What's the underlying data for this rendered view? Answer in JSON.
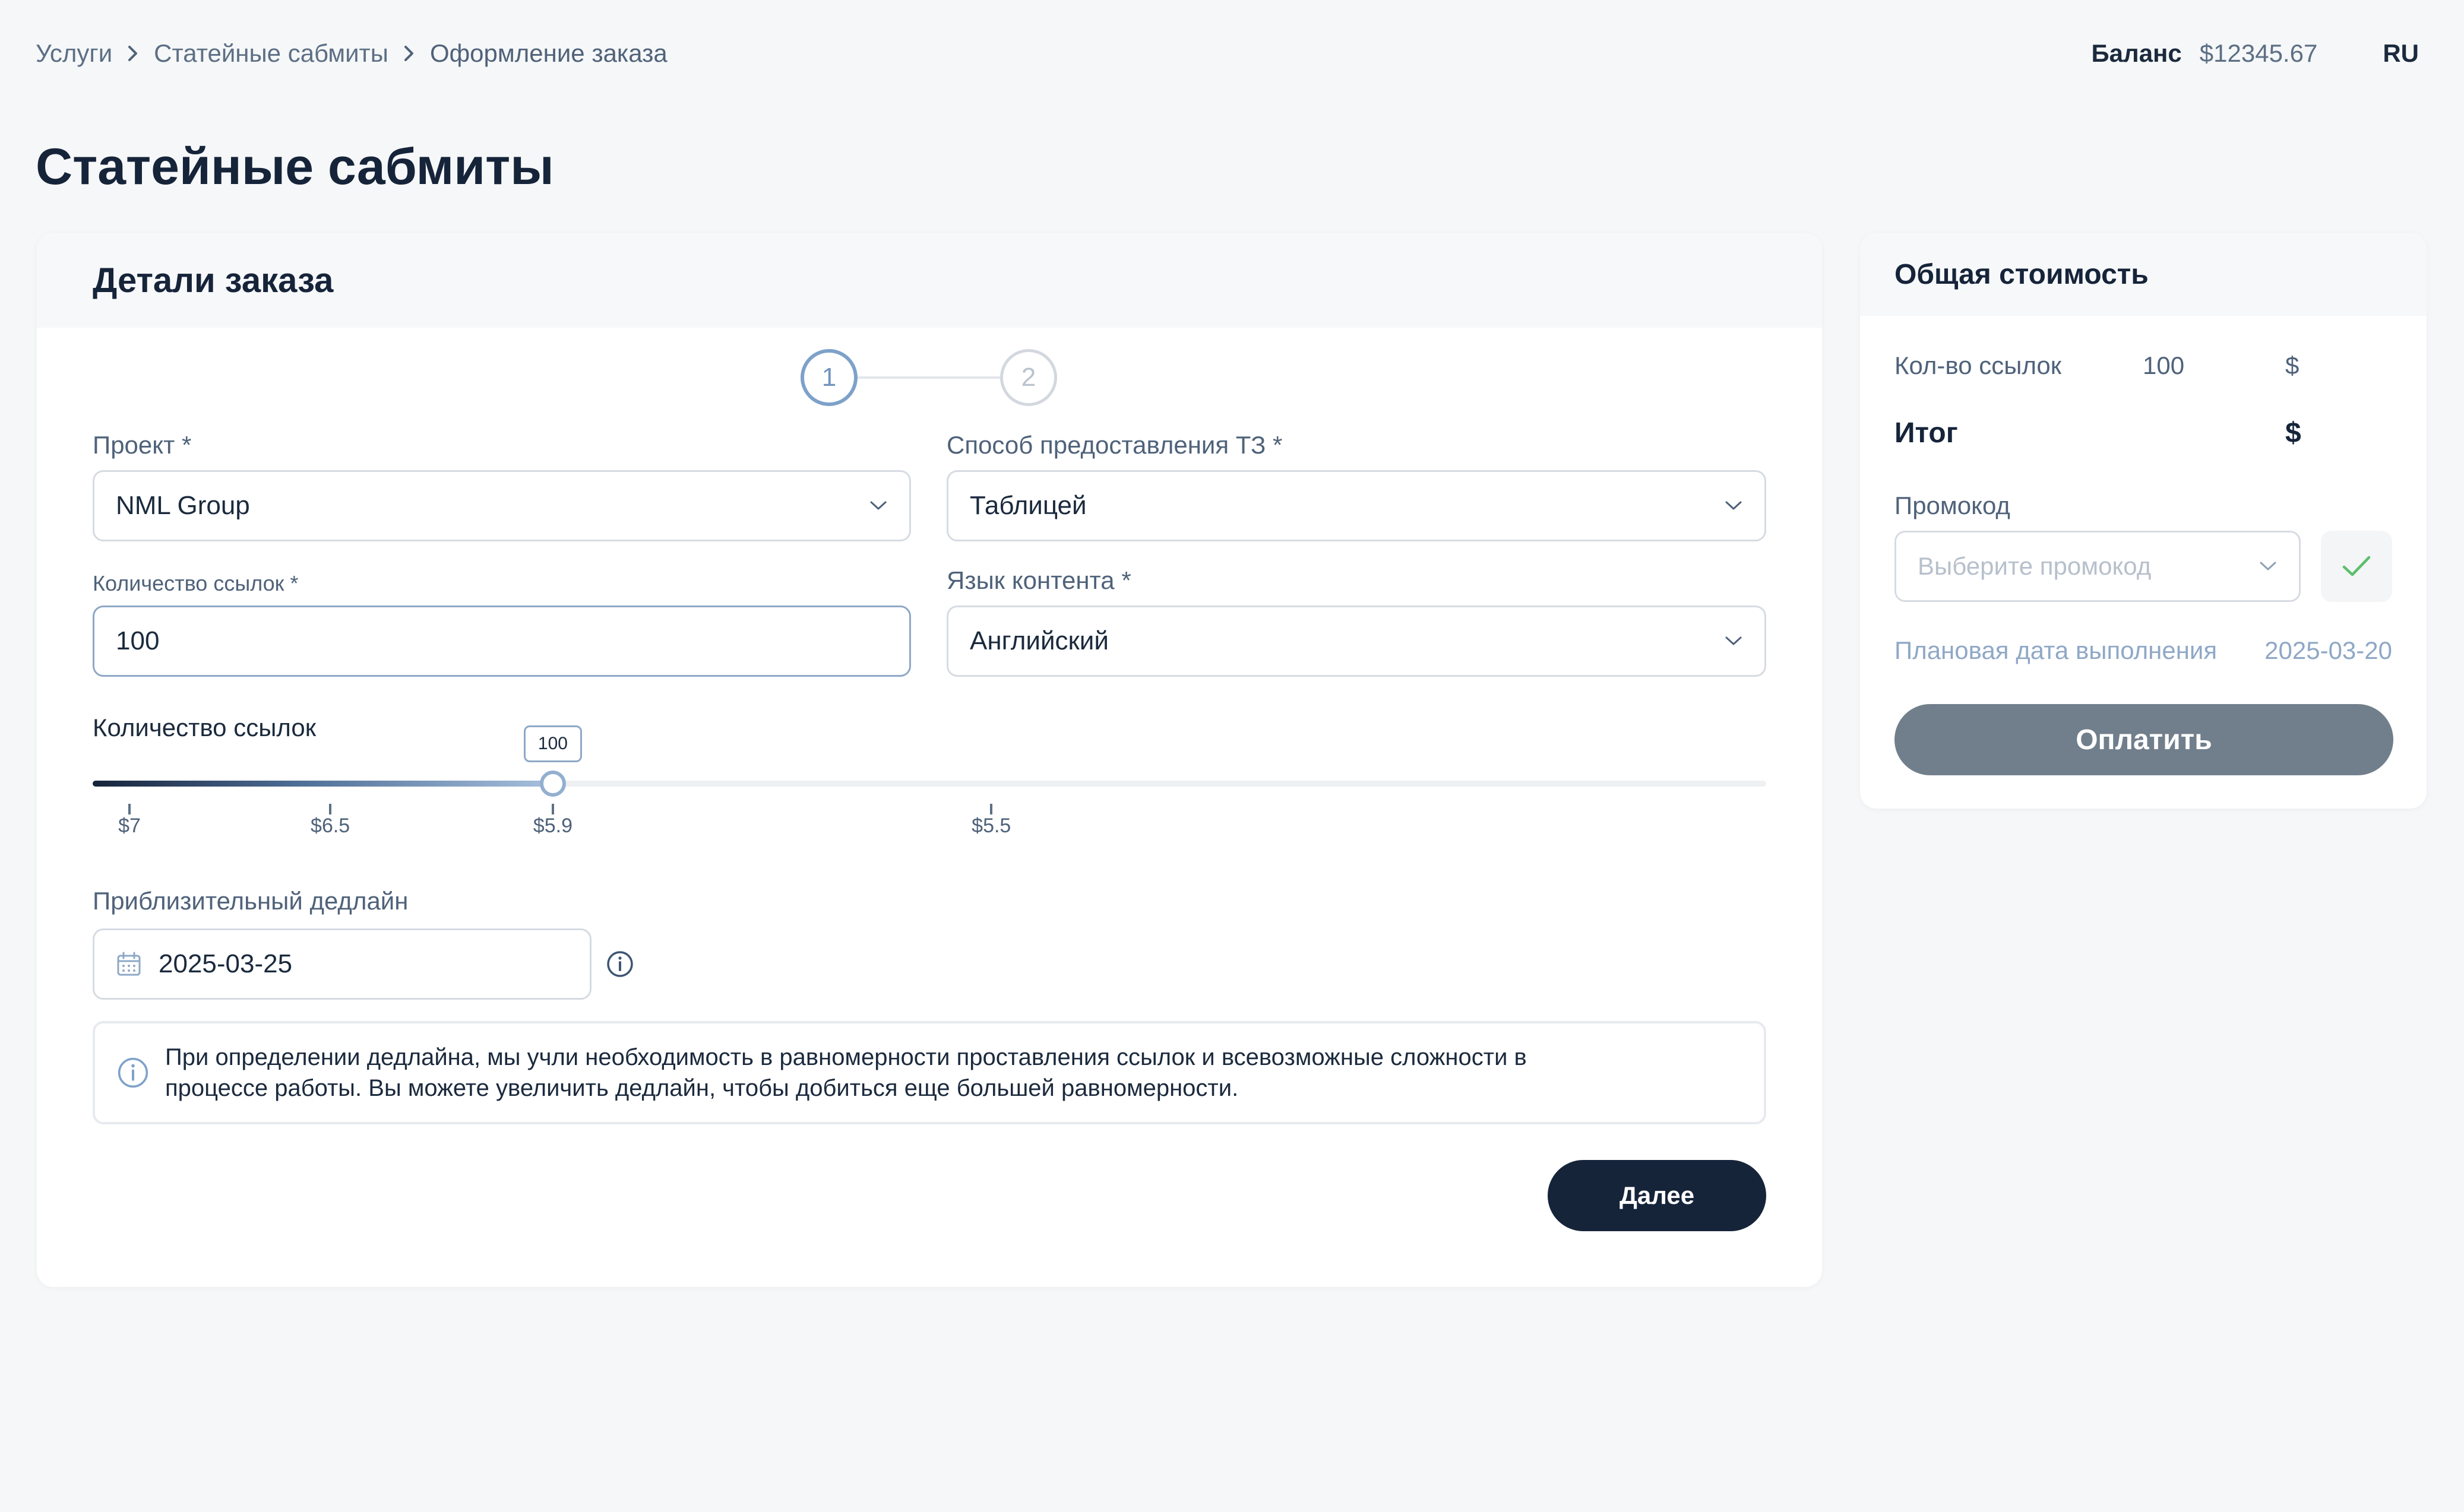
{
  "breadcrumb": {
    "items": [
      "Услуги",
      "Статейные сабмиты",
      "Оформление заказа"
    ]
  },
  "header": {
    "balance_label": "Баланс",
    "balance_value": "$12345.67",
    "language": "RU"
  },
  "page": {
    "title": "Статейные сабмиты"
  },
  "order": {
    "title": "Детали заказа",
    "steps": [
      "1",
      "2"
    ],
    "current_step": 1,
    "project": {
      "label": "Проект *",
      "value": "NML Group"
    },
    "tz_method": {
      "label": "Способ предоставления ТЗ *",
      "value": "Таблицей"
    },
    "links_count": {
      "label": "Количество ссылок *",
      "value": "100"
    },
    "content_language": {
      "label": "Язык контента *",
      "value": "Английский"
    },
    "slider": {
      "label": "Количество ссылок",
      "value": 100,
      "value_label": "100",
      "fill_fraction": 0.275,
      "ticks": [
        {
          "label": "$7",
          "position": 0.022
        },
        {
          "label": "$6.5",
          "position": 0.142
        },
        {
          "label": "$5.9",
          "position": 0.275
        },
        {
          "label": "$5.5",
          "position": 0.537
        }
      ]
    },
    "deadline": {
      "label": "Приблизительный дедлайн",
      "value": "2025-03-25"
    },
    "notice": {
      "line1": "При определении дедлайна, мы учли необходимость в равномерности проставления ссылок и всевозможные сложности в",
      "line2": "процессе работы. Вы можете увеличить дедлайн, чтобы добиться еще большей равномерности."
    },
    "next_label": "Далее"
  },
  "summary": {
    "title": "Общая стоимость",
    "links_label": "Кол-во ссылок",
    "links_value": "100",
    "links_currency": "$",
    "total_label": "Итог",
    "total_currency": "$",
    "promo_label": "Промокод",
    "promo_placeholder": "Выберите промокод",
    "plan_label": "Плановая дата выполнения",
    "plan_value": "2025-03-20",
    "pay_label": "Оплатить"
  },
  "icons": {
    "breadcrumb_separator": "chevron-right-icon",
    "select_arrow": "chevron-down-icon",
    "date": "calendar-icon",
    "info": "info-icon",
    "apply_promo": "check-icon"
  },
  "colors": {
    "primary_dark": "#16243a",
    "accent": "#7ea1c9",
    "pay_button": "#717f8c",
    "check": "#5cbf6a",
    "background": "#f6f7f8"
  }
}
